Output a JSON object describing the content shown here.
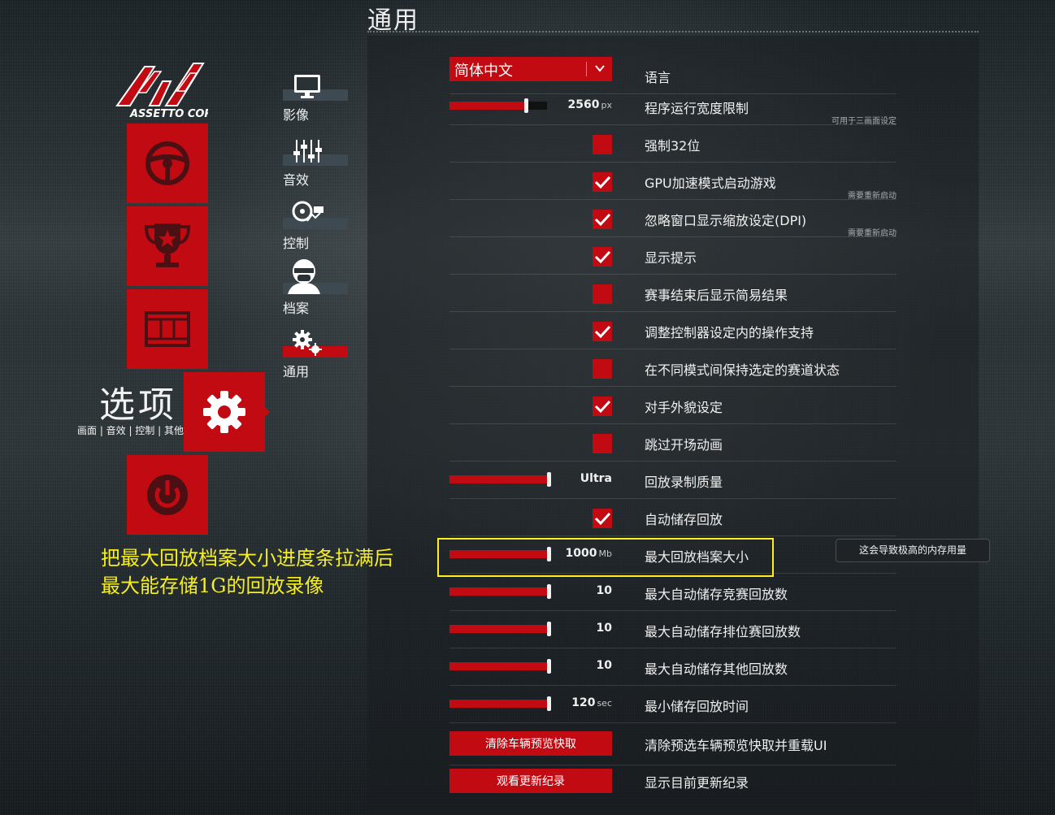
{
  "header": {
    "title": "通用"
  },
  "logo": {
    "text": "ASSETTO CORSA"
  },
  "main_nav": {
    "items": [
      {
        "icon": "steering-wheel-icon"
      },
      {
        "icon": "trophy-icon"
      },
      {
        "icon": "film-reel-icon"
      },
      {
        "icon": "gear-icon",
        "title": "选项",
        "subtitle": "画面 | 音效 | 控制 | 其他"
      },
      {
        "icon": "power-icon"
      }
    ]
  },
  "submenu": {
    "items": [
      {
        "label": "影像",
        "icon": "monitor-icon"
      },
      {
        "label": "音效",
        "icon": "equalizer-icon"
      },
      {
        "label": "控制",
        "icon": "controls-icon"
      },
      {
        "label": "档案",
        "icon": "driver-helmet-icon"
      },
      {
        "label": "通用",
        "icon": "gears-icon",
        "active": true
      }
    ]
  },
  "settings": {
    "language": {
      "value": "简体中文",
      "label": "语言"
    },
    "width_limit": {
      "value": "2560",
      "unit": "px",
      "label": "程序运行宽度限制",
      "note": "可用于三画面设定",
      "level": 0.8
    },
    "force32": {
      "label": "强制32位",
      "checked": false
    },
    "gpu_accel": {
      "label": "GPU加速模式启动游戏",
      "checked": true,
      "note": "需要重新启动"
    },
    "ignore_dpi": {
      "label": "忽略窗口显示缩放设定(DPI)",
      "checked": true,
      "note": "需要重新启动"
    },
    "show_hints": {
      "label": "显示提示",
      "checked": true
    },
    "simple_results": {
      "label": "赛事结束后显示简易结果",
      "checked": false
    },
    "controller_support": {
      "label": "调整控制器设定内的操作支持",
      "checked": true
    },
    "keep_track": {
      "label": "在不同模式间保持选定的赛道状态",
      "checked": false
    },
    "opponent_skins": {
      "label": "对手外貌设定",
      "checked": true
    },
    "skip_intro": {
      "label": "跳过开场动画",
      "checked": false
    },
    "replay_quality": {
      "value": "Ultra",
      "label": "回放录制质量",
      "level": 1.0
    },
    "auto_save_replay": {
      "label": "自动储存回放",
      "checked": true
    },
    "max_replay_size": {
      "value": "1000",
      "unit": "Mb",
      "label": "最大回放档案大小",
      "tooltip": "这会导致极高的内存用量",
      "level": 1.0
    },
    "max_race_replays": {
      "value": "10",
      "label": "最大自动储存竞赛回放数",
      "level": 1.0
    },
    "max_quali_replays": {
      "value": "10",
      "label": "最大自动储存排位赛回放数",
      "level": 1.0
    },
    "max_other_replays": {
      "value": "10",
      "label": "最大自动储存其他回放数",
      "level": 1.0
    },
    "min_replay_time": {
      "value": "120",
      "unit": "sec",
      "label": "最小储存回放时间",
      "level": 1.0
    },
    "clear_preview": {
      "button": "清除车辆预览快取",
      "label": "清除预选车辆预览快取并重载UI"
    },
    "changelog": {
      "button": "观看更新纪录",
      "label": "显示目前更新纪录"
    }
  },
  "annotation": {
    "line1": "把最大回放档案大小进度条拉满后",
    "line2": "最大能存储1G的回放录像"
  },
  "colors": {
    "accent": "#c10a12",
    "highlight": "#ffee22"
  }
}
